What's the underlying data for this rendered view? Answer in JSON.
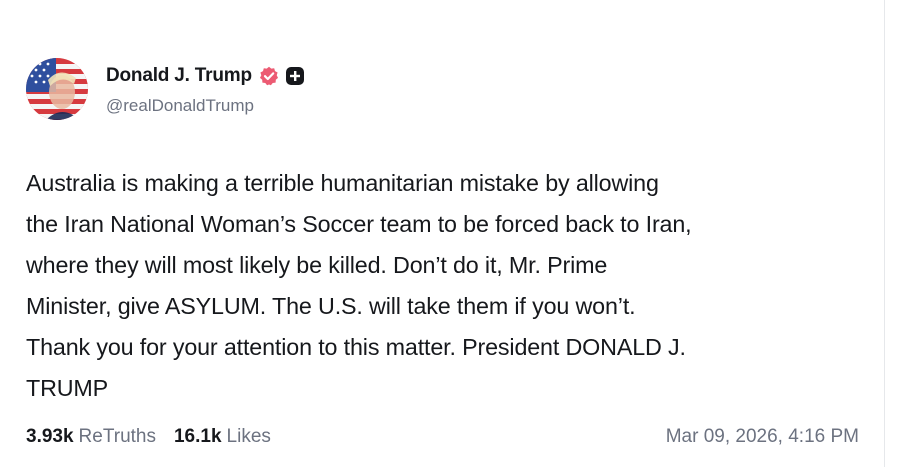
{
  "author": {
    "display_name": "Donald J. Trump",
    "handle": "@realDonaldTrump",
    "avatar_icon": "avatar-flag-portrait",
    "verified_icon": "verified-badge-icon",
    "verified_color": "#ec5b73",
    "extra_badge_icon": "plus-badge-icon"
  },
  "post": {
    "text": "Australia is making a terrible humanitarian mistake by allowing\nthe Iran National Woman’s Soccer team to be forced back to Iran,\nwhere they will most likely be killed. Don’t do it, Mr. Prime\nMinister, give ASYLUM. The U.S. will take them if you won’t.\nThank you for your attention to this matter. President DONALD J.\nTRUMP"
  },
  "stats": {
    "retruths_count": "3.93k",
    "retruths_label": "ReTruths",
    "likes_count": "16.1k",
    "likes_label": "Likes"
  },
  "timestamp": "Mar 09, 2026, 4:16 PM"
}
